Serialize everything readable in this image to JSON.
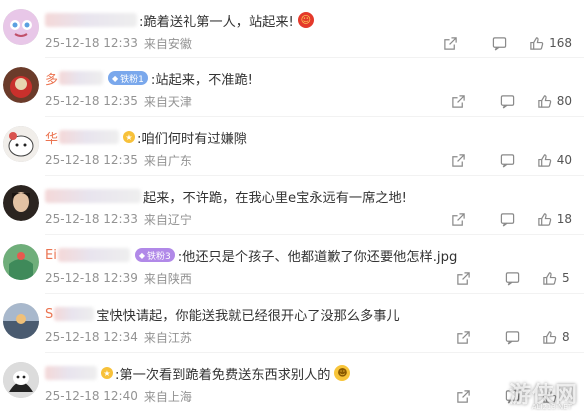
{
  "comments": [
    {
      "name_visible": "",
      "badge": "",
      "content": ":跪着送礼第一人，站起来!",
      "date": "25-12-18 12:33",
      "location": "来自安徽",
      "likes": "168",
      "emoji": "laugh-emoji",
      "avatar_color": "#e8c7e8"
    },
    {
      "name_visible": "多",
      "badge": "铁粉1",
      "content": ":站起来，不准跪!",
      "date": "25-12-18 12:35",
      "location": "来自天津",
      "likes": "80",
      "emoji": "",
      "avatar_color": "#6b3b2a"
    },
    {
      "name_visible": "华",
      "badge": "",
      "content": ":咱们何时有过嫌隙",
      "date": "25-12-18 12:35",
      "location": "来自广东",
      "likes": "40",
      "emoji": "",
      "avatar_color": "#f1eeea"
    },
    {
      "name_visible": "",
      "badge": "",
      "content": "起来，不许跪，在我心里e宝永远有一席之地!",
      "date": "25-12-18 12:33",
      "location": "来自辽宁",
      "likes": "18",
      "emoji": "",
      "avatar_color": "#2b2420"
    },
    {
      "name_visible": "Ei",
      "badge": "铁粉3",
      "content": ":他还只是个孩子、他都道歉了你还要他怎样.jpg",
      "date": "25-12-18 12:39",
      "location": "来自陕西",
      "likes": "5",
      "emoji": "",
      "avatar_color": "#3f8a5a"
    },
    {
      "name_visible": "S",
      "badge": "",
      "content": "宝快快请起，你能送我就已经很开心了没那么多事儿",
      "date": "25-12-18 12:34",
      "location": "来自江苏",
      "likes": "8",
      "emoji": "",
      "avatar_color": "#7a8fa8"
    },
    {
      "name_visible": "",
      "badge": "",
      "content": ":第一次看到跪着免费送东西求别人的",
      "date": "25-12-18 12:40",
      "location": "来自上海",
      "likes": "",
      "emoji": "grin-emoji",
      "avatar_color": "#2a2a2a"
    }
  ],
  "watermark": "游侠网",
  "watermark_sub": "ALI213.NET",
  "colors": {
    "name": "#eb7350",
    "meta": "#939393",
    "text": "#333333"
  }
}
